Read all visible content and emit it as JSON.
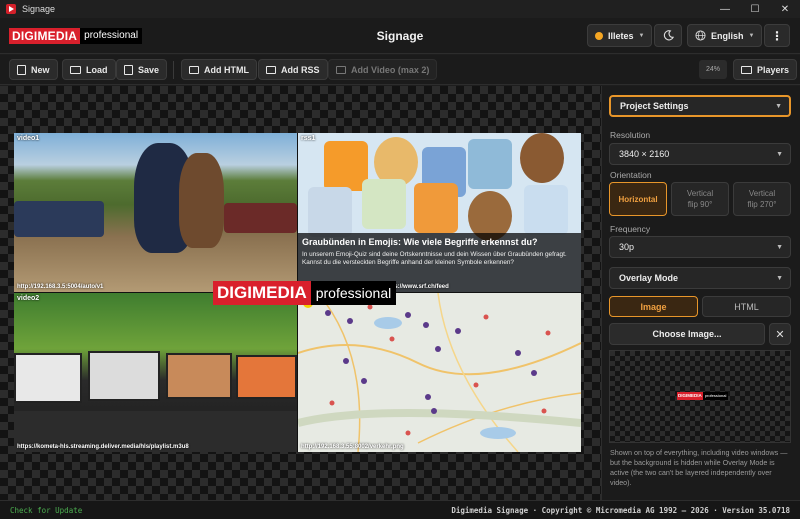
{
  "window": {
    "title": "Signage",
    "minimize": "—",
    "maximize": "☐",
    "close": "✕"
  },
  "header": {
    "logo_red": "DIGIMEDIA",
    "logo_black": "professional",
    "title": "Signage",
    "user_label": "Illetes",
    "theme_icon": "moon-icon",
    "language_label": "English",
    "menu_icon": "⋮"
  },
  "toolbar": {
    "new_label": "New",
    "load_label": "Load",
    "save_label": "Save",
    "add_html_label": "Add HTML",
    "add_rss_label": "Add RSS",
    "add_video_label": "Add Video (max 2)",
    "zoom_label": "24%",
    "players_label": "Players"
  },
  "canvas": {
    "tiles": [
      {
        "label": "video1",
        "url": "http://192.168.3.5:5004/auto/v1"
      },
      {
        "label": "rss1",
        "url": "https://www.srf.ch/feed",
        "headline": "Graubünden in Emojis: Wie viele Begriffe erkennst du?",
        "description": "In unserem Emoji-Quiz sind deine Ortskenntnisse und dein Wissen über Graubünden gefragt. Kannst du die versteckten Begriffe anhand der kleinen Symbole erkennen?"
      },
      {
        "label": "video2",
        "url": "https://kometa-hls.streaming.deliver.media/hls/playlist.m3u8"
      },
      {
        "label": "",
        "url": "http://192.168.3.55:8002/verkehr.png"
      }
    ],
    "overlay_logo_red": "DIGIMEDIA",
    "overlay_logo_black": "professional"
  },
  "panel": {
    "project_settings_label": "Project Settings",
    "resolution_label": "Resolution",
    "resolution_value": "3840 × 2160",
    "orientation_label": "Orientation",
    "orient_horizontal": "Horizontal",
    "orient_v90_line1": "Vertical",
    "orient_v90_line2": "flip 90°",
    "orient_v270_line1": "Vertical",
    "orient_v270_line2": "flip 270°",
    "frequency_label": "Frequency",
    "frequency_value": "30p",
    "overlay_mode_label": "Overlay Mode",
    "mode_image": "Image",
    "mode_html": "HTML",
    "choose_image_label": "Choose Image...",
    "clear_label": "✕",
    "preview_logo_red": "DIGIMEDIA",
    "preview_logo_black": "professional",
    "help_text": "Shown on top of everything, including video windows — but the background is hidden while Overlay Mode is active (the two can't be layered independently over video)."
  },
  "statusbar": {
    "check_update": "Check for Update",
    "copyright": "Digimedia Signage · Copyright © Micromedia AG 1992 – 2026 · Version 35.0718"
  },
  "colors": {
    "accent": "#e8962a",
    "brand_red": "#d9202c",
    "status_dot": "#f5a623",
    "update_green": "#4caf50"
  }
}
